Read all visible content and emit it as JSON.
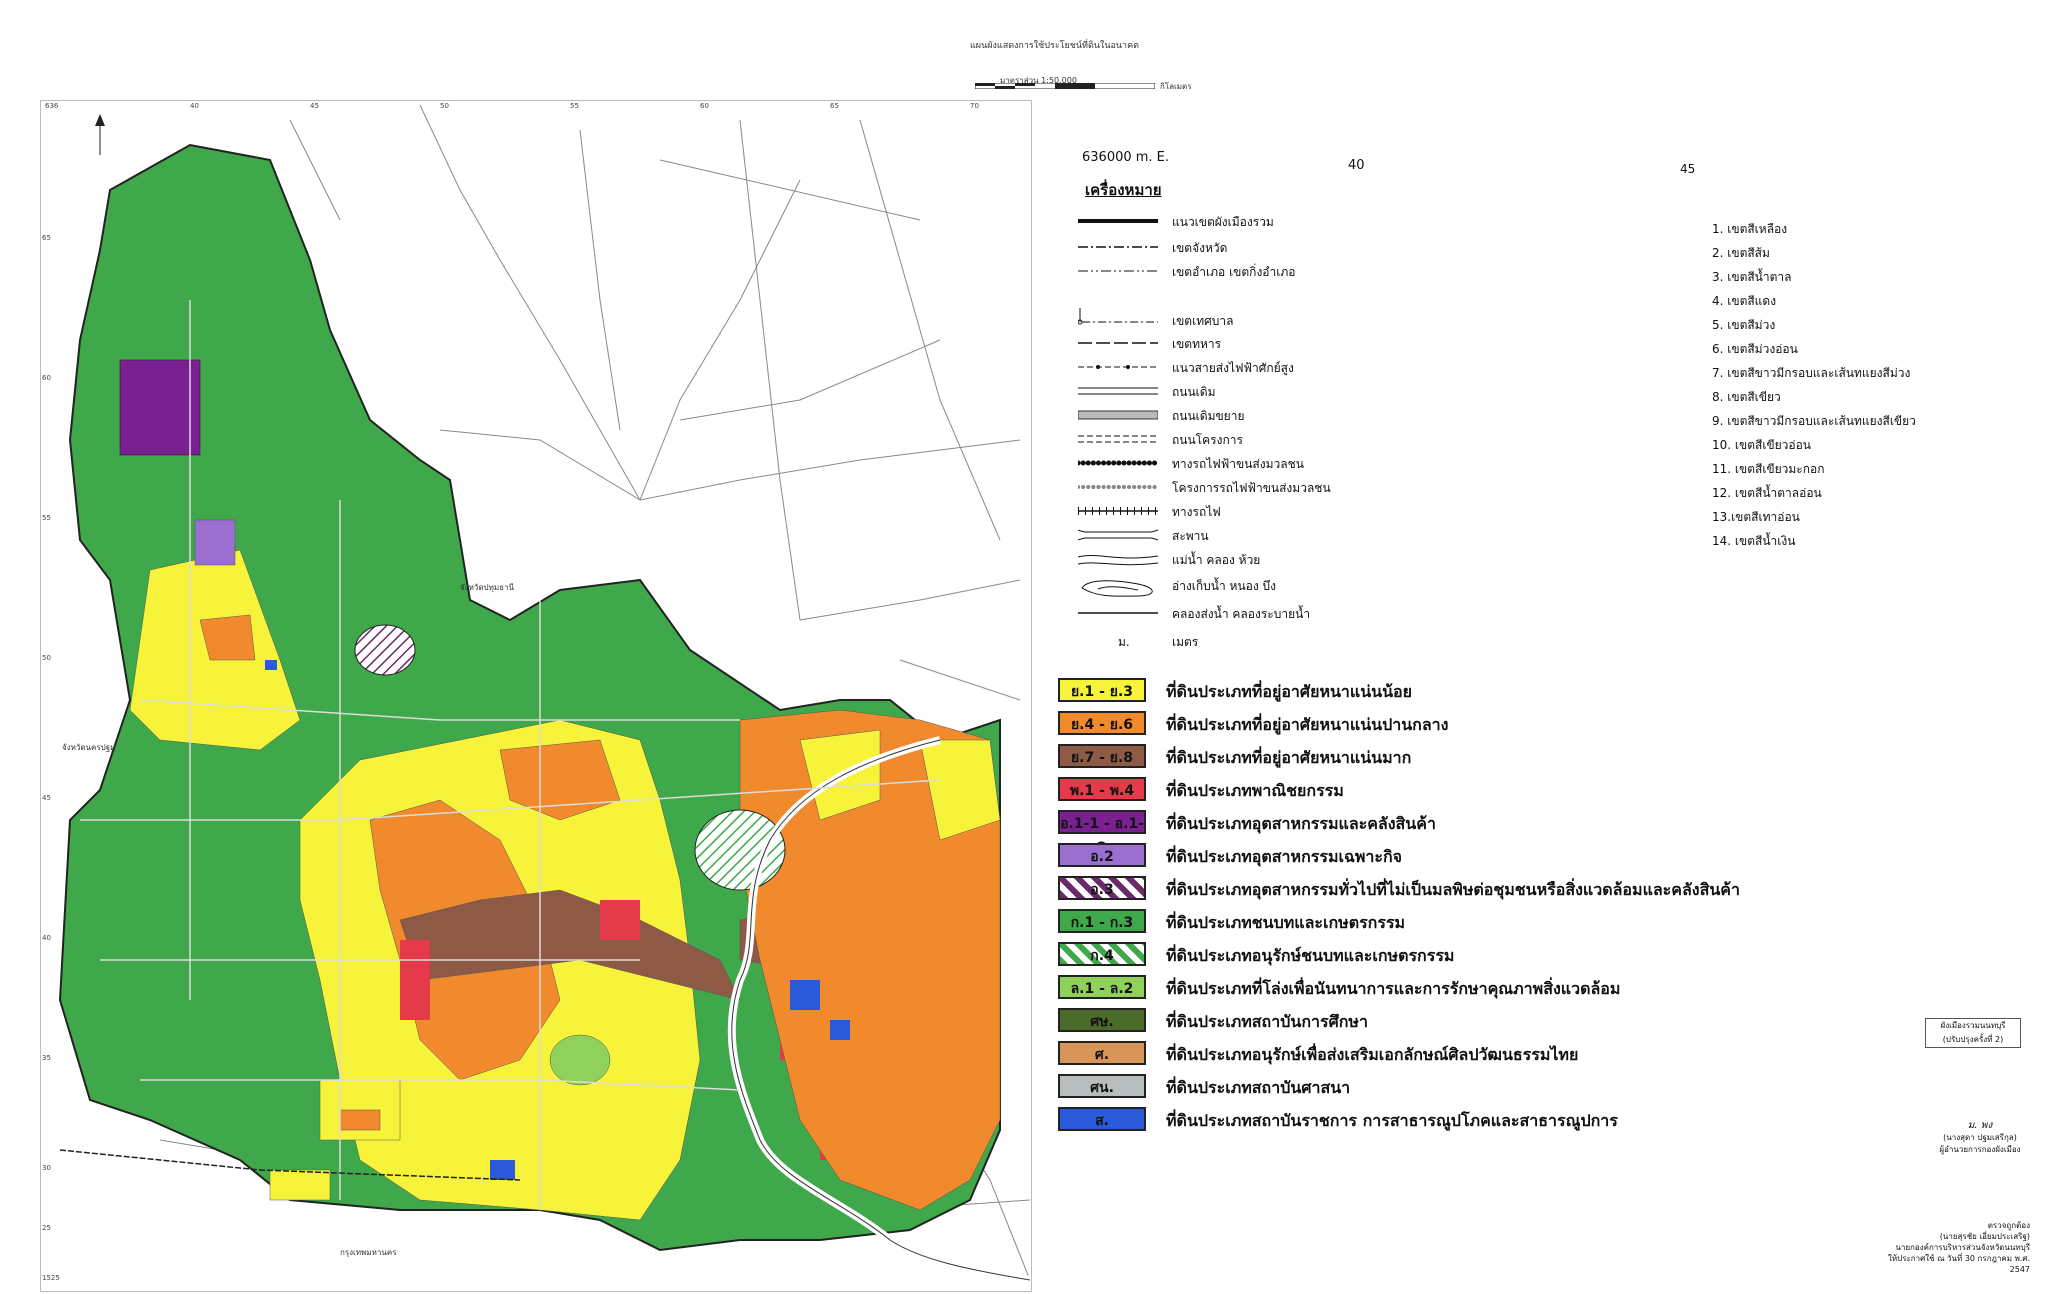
{
  "header": {
    "title": "แผนผังแสดงการใช้ประโยชน์ที่ดินในอนาคต",
    "scale_label": "มาตราส่วน 1:50,000",
    "scale_unit": "กิโลเมตร"
  },
  "map": {
    "place_labels": [
      {
        "name": "จังหวัดปทุมธานี"
      },
      {
        "name": "จังหวัดนครปฐม"
      },
      {
        "name": "กรุงเทพมหานคร"
      }
    ],
    "tick_labels_top": [
      "636",
      "40",
      "45",
      "50",
      "55",
      "60",
      "65",
      "70"
    ],
    "tick_labels_left": [
      "65",
      "60",
      "55",
      "50",
      "45",
      "40",
      "35",
      "30",
      "25",
      "1525"
    ]
  },
  "coords": {
    "easting": "636000 m. E.",
    "c40": "40",
    "c45": "45"
  },
  "legend": {
    "title": "เครื่องหมาย",
    "symbols": [
      {
        "label": "แนวเขตผังเมืองรวม",
        "style": "thick"
      },
      {
        "label": "เขตจังหวัด",
        "style": "dashdot"
      },
      {
        "label": "เขตอำเภอ เขตกิ่งอำเภอ",
        "style": "dashdotdot"
      },
      {
        "label": "เขตเทศบาล",
        "style": "municipal"
      },
      {
        "label": "เขตทหาร",
        "style": "longdash"
      },
      {
        "label": "แนวสายส่งไฟฟ้าศักย์สูง",
        "style": "dotdash"
      },
      {
        "label": "ถนนเดิม",
        "style": "double"
      },
      {
        "label": "ถนนเดิมขยาย",
        "style": "doublegray"
      },
      {
        "label": "ถนนโครงการ",
        "style": "doubledash"
      },
      {
        "label": "ทางรถไฟฟ้าขนส่งมวลชน",
        "style": "circles"
      },
      {
        "label": "โครงการรถไฟฟ้าขนส่งมวลชน",
        "style": "circleslight"
      },
      {
        "label": "ทางรถไฟ",
        "style": "rail"
      },
      {
        "label": "สะพาน",
        "style": "bridge"
      },
      {
        "label": "แม่น้ำ คลอง ห้วย",
        "style": "river"
      },
      {
        "label": "อ่างเก็บน้ำ หนอง บึง",
        "style": "pond"
      },
      {
        "label": "คลองส่งน้ำ คลองระบายน้ำ",
        "style": "canal"
      },
      {
        "label": "เมตร",
        "style": "text",
        "code": "ม."
      }
    ],
    "numbered": [
      "1. เขตสีเหลือง",
      "2. เขตสีส้ม",
      "3. เขตสีน้ำตาล",
      "4. เขตสีแดง",
      "5. เขตสีม่วง",
      "6. เขตสีม่วงอ่อน",
      "7. เขตสีขาวมีกรอบและเส้นทแยงสีม่วง",
      "8. เขตสีเขียว",
      "9. เขตสีขาวมีกรอบและเส้นทแยงสีเขียว",
      "10. เขตสีเขียวอ่อน",
      "11. เขตสีเขียวมะกอก",
      "12. เขตสีน้ำตาลอ่อน",
      "13.เขตสีเทาอ่อน",
      "14. เขตสีน้ำเงิน"
    ],
    "zones": [
      {
        "code": "ย.1 - ย.3",
        "desc": "ที่ดินประเภทที่อยู่อาศัยหนาแน่นน้อย",
        "color": "#f7f33a",
        "text_color": "#111",
        "hatch": ""
      },
      {
        "code": "ย.4 - ย.6",
        "desc": "ที่ดินประเภทที่อยู่อาศัยหนาแน่นปานกลาง",
        "color": "#f08a2c",
        "text_color": "#111",
        "hatch": ""
      },
      {
        "code": "ย.7 - ย.8",
        "desc": "ที่ดินประเภทที่อยู่อาศัยหนาแน่นมาก",
        "color": "#8f5a45",
        "text_color": "#111",
        "hatch": ""
      },
      {
        "code": "พ.1 - พ.4",
        "desc": "ที่ดินประเภทพาณิชยกรรม",
        "color": "#e43a4a",
        "text_color": "#111",
        "hatch": ""
      },
      {
        "code": "อ.1-1 - อ.1-2",
        "desc": "ที่ดินประเภทอุตสาหกรรมและคลังสินค้า",
        "color": "#7a2090",
        "text_color": "#111",
        "hatch": ""
      },
      {
        "code": "อ.2",
        "desc": "ที่ดินประเภทอุตสาหกรรมเฉพาะกิจ",
        "color": "#9b6fd0",
        "text_color": "#111",
        "hatch": ""
      },
      {
        "code": "อ.3",
        "desc": "ที่ดินประเภทอุตสาหกรรมทั่วไปที่ไม่เป็นมลพิษต่อชุมชนหรือสิ่งแวดล้อมและคลังสินค้า",
        "color": "#ffffff",
        "text_color": "#111",
        "hatch": "#6a2a6a"
      },
      {
        "code": "ก.1 - ก.3",
        "desc": "ที่ดินประเภทชนบทและเกษตรกรรม",
        "color": "#3fa84a",
        "text_color": "#111",
        "hatch": ""
      },
      {
        "code": "ก.4",
        "desc": "ที่ดินประเภทอนุรักษ์ชนบทและเกษตรกรรม",
        "color": "#ffffff",
        "text_color": "#111",
        "hatch": "#3fa84a"
      },
      {
        "code": "ล.1 - ล.2",
        "desc": "ที่ดินประเภทที่โล่งเพื่อนันทนาการและการรักษาคุณภาพสิ่งแวดล้อม",
        "color": "#8fd15a",
        "text_color": "#111",
        "hatch": ""
      },
      {
        "code": "ศษ.",
        "desc": "ที่ดินประเภทสถาบันการศึกษา",
        "color": "#4a6a2a",
        "text_color": "#111",
        "hatch": ""
      },
      {
        "code": "ศ.",
        "desc": "ที่ดินประเภทอนุรักษ์เพื่อส่งเสริมเอกลักษณ์ศิลปวัฒนธรรมไทย",
        "color": "#d8955a",
        "text_color": "#111",
        "hatch": ""
      },
      {
        "code": "ศน.",
        "desc": "ที่ดินประเภทสถาบันศาสนา",
        "color": "#b8bdbd",
        "text_color": "#111",
        "hatch": ""
      },
      {
        "code": "ส.",
        "desc": "ที่ดินประเภทสถาบันราชการ การสาธารณูปโภคและสาธารณูปการ",
        "color": "#2a5ad8",
        "text_color": "#111",
        "hatch": ""
      }
    ]
  },
  "footer": {
    "edition_line1": "ผังเมืองรวมนนทบุรี",
    "edition_line2": "(ปรับปรุงครั้งที่ 2)",
    "sign1_line1": "ม. พง",
    "sign1_line2": "(นางสุดา ปฐมเสรีกุล)",
    "sign1_line3": "ผู้อำนวยการกองผังเมือง",
    "sign2_line1": "ตรวจถูกต้อง",
    "sign2_line2": "(นายสุรชัย เอี่ยมประเสริฐ)",
    "sign2_line3": "นายกองค์การบริหารส่วนจังหวัดนนทบุรี",
    "sign2_line4": "ให้ประกาศใช้ ณ วันที่ 30 กรกฎาคม พ.ศ. 2547"
  }
}
